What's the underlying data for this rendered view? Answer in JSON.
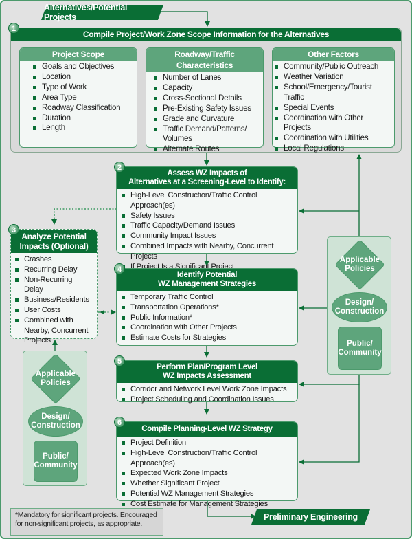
{
  "colors": {
    "primary_green": "#0a6e35",
    "mid_green": "#5ea57c",
    "light_green": "#cfe3d6",
    "background_gray": "#e2e2e2",
    "box_fill": "#f3f7f5"
  },
  "start_label": "Alternatives/Potential Projects",
  "end_label": "Preliminary Engineering",
  "step1": {
    "number": "1",
    "title": "Compile Project/Work Zone Scope Information for the Alternatives",
    "groups": [
      {
        "title": "Project Scope",
        "items": [
          "Goals and Objectives",
          "Location",
          "Type of Work",
          "Area Type",
          "Roadway Classification",
          "Duration",
          "Length"
        ]
      },
      {
        "title": "Roadway/Traffic Characteristics",
        "items": [
          "Number of Lanes",
          "Capacity",
          "Cross-Sectional Details",
          "Pre-Existing Safety Issues",
          "Grade and Curvature",
          "Traffic Demand/Patterns/ Volumes",
          "Alternate Routes"
        ]
      },
      {
        "title": "Other Factors",
        "items": [
          "Community/Public Outreach",
          "Weather Variation",
          "School/Emergency/Tourist Traffic",
          "Special Events",
          "Coordination with Other Projects",
          "Coordination with Utilities",
          "Local Regulations"
        ]
      }
    ]
  },
  "step2": {
    "number": "2",
    "title_line1": "Assess WZ Impacts of",
    "title_line2": "Alternatives at a Screening-Level to Identify:",
    "items": [
      "High-Level Construction/Traffic Control Approach(es)",
      "Safety Issues",
      "Traffic Capacity/Demand Issues",
      "Community Impact Issues",
      "Combined Impacts with Nearby, Concurrent Projects",
      "If Project Is a Significant Project"
    ]
  },
  "step3": {
    "number": "3",
    "title_line1": "Analyze Potential",
    "title_line2": "Impacts (Optional)",
    "items": [
      "Crashes",
      "Recurring Delay",
      "Non-Recurring Delay",
      "Business/Residents",
      "User Costs",
      "Combined with Nearby, Concurrent Projects"
    ]
  },
  "step4": {
    "number": "4",
    "title_line1": "Identify Potential",
    "title_line2": "WZ Management Strategies",
    "items": [
      "Temporary Traffic Control",
      "Transportation Operations*",
      "Public Information*",
      "Coordination with Other Projects",
      "Estimate Costs for Strategies"
    ]
  },
  "step5": {
    "number": "5",
    "title_line1": "Perform Plan/Program Level",
    "title_line2": "WZ Impacts Assessment",
    "items": [
      "Corridor and Network Level Work Zone Impacts",
      "Project Scheduling and Coordination Issues"
    ]
  },
  "step6": {
    "number": "6",
    "title": "Compile Planning-Level WZ Strategy",
    "items": [
      "Project Definition",
      "High-Level Construction/Traffic Control Approach(es)",
      "Expected Work Zone Impacts",
      "Whether Significant Project",
      "Potential WZ Management Strategies",
      "Cost Estimate for Management Strategies"
    ]
  },
  "policy_panels": {
    "applicable_policies": "Applicable Policies",
    "design_construction": "Design/ Construction",
    "public_community": "Public/ Community"
  },
  "footnote": "*Mandatory for significant projects.  Encouraged for non-significant projects, as appropriate."
}
